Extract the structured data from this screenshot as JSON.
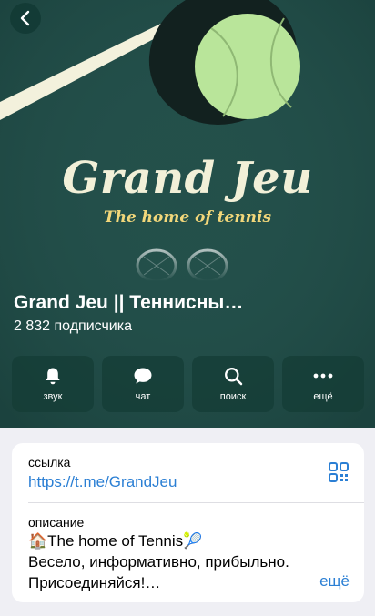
{
  "header": {
    "back_icon": "chevron-left-icon",
    "logo_title": "Grand Jeu",
    "logo_subtitle": "The home of tennis"
  },
  "channel": {
    "name": "Grand Jeu || Теннисны…",
    "subscribers": "2 832 подписчика"
  },
  "actions": [
    {
      "label": "звук",
      "icon": "bell-icon"
    },
    {
      "label": "чат",
      "icon": "chat-bubble-icon"
    },
    {
      "label": "поиск",
      "icon": "search-icon"
    },
    {
      "label": "ещё",
      "icon": "more-dots-icon"
    }
  ],
  "info": {
    "link_label": "ссылка",
    "link_value": "https://t.me/GrandJeu",
    "description_label": "описание",
    "description_line1": "🏠The home of Tennis🎾",
    "description_line2": "Весело, информативно, прибыльно.",
    "description_line3": "Присоединяйся!…",
    "more_label": "ещё"
  },
  "colors": {
    "hero_background": "#234f4a",
    "link": "#2b7fd4",
    "ball": "#b9e59a"
  }
}
